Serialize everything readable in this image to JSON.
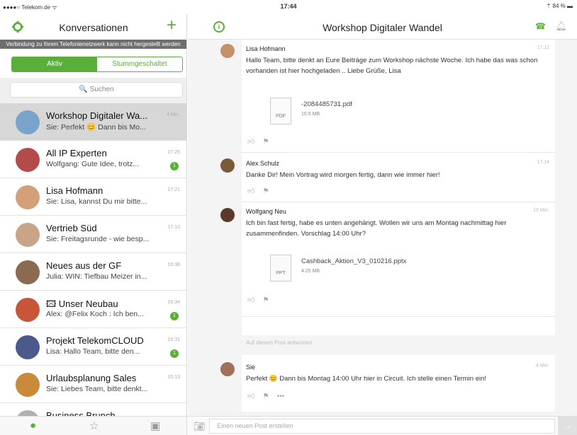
{
  "status": {
    "carrier": "●●●●○ Telekom.de ᯤ",
    "time": "17:44",
    "battery": "⇡ 84 % ▬"
  },
  "left": {
    "title": "Konversationen",
    "banner": "Verbindung zu Ihrem Telefonienetzwerk kann nicht hergestellt werden",
    "tabs": {
      "active": "Aktiv",
      "muted": "Stummgeschaltet"
    },
    "search_placeholder": "🔍 Suchen",
    "conversations": [
      {
        "name": "Workshop Digitaler Wa...",
        "preview": "Sie: Perfekt 😊 Dann bis Mo...",
        "time": "4 Min.",
        "badge": "",
        "color": "#7aa3c9"
      },
      {
        "name": "All IP Experten",
        "preview": "Wolfgang: Gute Idee, trotz...",
        "time": "17:25",
        "badge": "1",
        "color": "#b54a4a"
      },
      {
        "name": "Lisa Hofmann",
        "preview": "Sie: Lisa, kannst Du mir bitte...",
        "time": "17:21",
        "badge": "",
        "color": "#d4a07a"
      },
      {
        "name": "Vertrieb Süd",
        "preview": "Sie: Freitagsrunde - wie besp...",
        "time": "17:13",
        "badge": "",
        "color": "#c9a486"
      },
      {
        "name": "Neues aus der GF",
        "preview": "Julia: WIN: Tiefbau Meizer in...",
        "time": "16:38",
        "badge": "",
        "color": "#8c6a52"
      },
      {
        "name": "🖾 Unser Neubau",
        "preview": "Alex: @Felix Koch : Ich ben...",
        "time": "16:34",
        "badge": "1",
        "color": "#c8553a"
      },
      {
        "name": "Projekt TelekomCLOUD",
        "preview": "Lisa: Hallo Team, bitte den...",
        "time": "16:31",
        "badge": "1",
        "color": "#4a5a8c"
      },
      {
        "name": "Urlaubsplanung Sales",
        "preview": "Sie: Liebes Team, bitte denkt...",
        "time": "15:13",
        "badge": "",
        "color": "#c98a3a"
      },
      {
        "name": "Business Brunch",
        "preview": "",
        "time": "",
        "badge": "",
        "color": "#b0b0b0"
      }
    ],
    "tabbar": {
      "chat": "●",
      "star": "☆",
      "list": "▣"
    }
  },
  "right": {
    "title": "Workshop Digitaler Wandel",
    "posts": [
      {
        "author": "Lisa Hofmann",
        "time": "17:12",
        "text": "Hallo Team, bitte denkt an Eure Beiträge zum Workshop nächste Woche. Ich habe das was schon vorhanden ist hier hochgeladen .. Liebe Grüße, Lisa",
        "file": {
          "name": "-2084485731.pdf",
          "size": "16.5 MB",
          "type": "PDF"
        },
        "color": "#c4906a"
      },
      {
        "author": "Alex Schulz",
        "time": "17:14",
        "text": "Danke Dir! Mein Vortrag wird morgen fertig, dann wie immer hier!",
        "color": "#7a5a3a"
      },
      {
        "author": "Wolfgang Neu",
        "time": "10 Min.",
        "text": "Ich bin fast fertig, habe es unten angehängt. Wollen wir uns am Montag nachmittag hier zusammenfinden. Vorschlag 14:00 Uhr?",
        "file": {
          "name": "Cashback_Aktion_V3_010216.pptx",
          "size": "4.25 MB",
          "type": "PPT"
        },
        "color": "#5a3a2a"
      },
      {
        "author": "Sie",
        "time": "4 Min.",
        "text": "Perfekt 😊 Dann bis Montag 14:00 Uhr hier in Circuit. Ich stelle einen Termin ein!",
        "color": "#a0705a"
      }
    ],
    "reply_hint": "Auf diesen Post antworten",
    "composer_placeholder": "Einen neuen Post erstellen",
    "more": "•••"
  }
}
